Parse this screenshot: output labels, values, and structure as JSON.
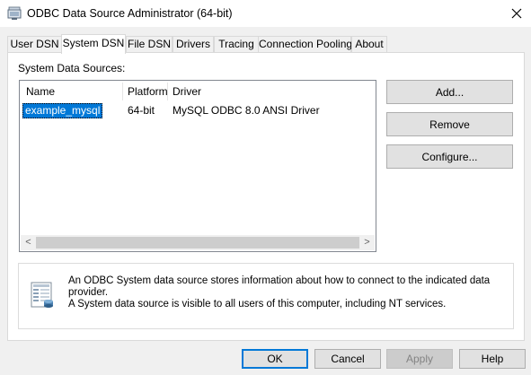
{
  "window": {
    "title": "ODBC Data Source Administrator (64-bit)",
    "icon": "odbc-admin-icon",
    "close_icon": "close-icon"
  },
  "tabs": [
    {
      "label": "User DSN",
      "active": false
    },
    {
      "label": "System DSN",
      "active": true
    },
    {
      "label": "File DSN",
      "active": false
    },
    {
      "label": "Drivers",
      "active": false
    },
    {
      "label": "Tracing",
      "active": false
    },
    {
      "label": "Connection Pooling",
      "active": false
    },
    {
      "label": "About",
      "active": false
    }
  ],
  "panel": {
    "section_label": "System Data Sources:",
    "columns": [
      "Name",
      "Platform",
      "Driver"
    ],
    "rows": [
      {
        "name": "example_mysql",
        "platform": "64-bit",
        "driver": "MySQL ODBC 8.0 ANSI Driver",
        "selected": true
      }
    ],
    "scroll_left": "<",
    "scroll_right": ">"
  },
  "side_buttons": {
    "add": "Add...",
    "remove": "Remove",
    "configure": "Configure..."
  },
  "info": {
    "line1": "An ODBC System data source stores information about how to connect to the indicated data provider.",
    "line2": "A System data source is visible to all users of this computer, including NT services."
  },
  "footer_buttons": {
    "ok": "OK",
    "cancel": "Cancel",
    "apply": "Apply",
    "help": "Help"
  },
  "colors": {
    "selection": "#0078d7",
    "window_bg": "#f0f0f0",
    "default_button_border": "#0078d7"
  }
}
